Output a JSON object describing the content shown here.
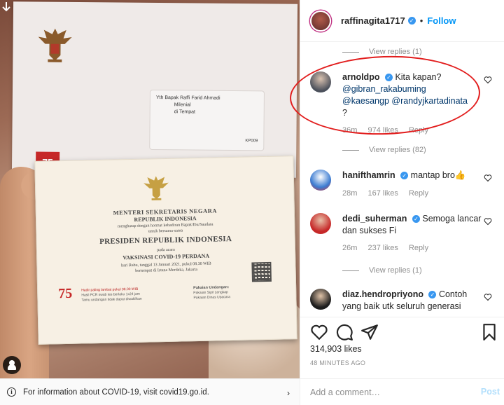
{
  "photo": {
    "envelope": {
      "recipient_line1": "Yth Bapak Raffi Farid Ahmadi",
      "recipient_line2": "Milenial",
      "recipient_line3": "di Tempat",
      "code": "KP009",
      "emblem_text": "75"
    },
    "invitation": {
      "title1": "MENTERI SEKRETARIS NEGARA",
      "title2": "REPUBLIK INDONESIA",
      "small1": "mengharap dengan hormat kehadiran Bapak/Ibu/Saudara",
      "small2": "untuk bersama-sama",
      "head": "PRESIDEN REPUBLIK INDONESIA",
      "small3": "pada acara",
      "event": "VAKSINASI COVID-19 PERDANA",
      "small4": "hari Rabu, tanggal 13 Januari 2021, pukul 08.30 WIB",
      "small5": "bertempat di Istana Merdeka, Jakarta",
      "emblem_text": "75",
      "notes_line1": "Hadir paling lambat pukul 08.00 WIB",
      "notes_line2": "Hasil PCR swab tes berlaku 1x24 jam",
      "notes_line3": "Tamu undangan tidak dapat diwakilkan",
      "dress_title": "Pakaian Undangan:",
      "dress_line1": "Pakaian Sipil Lengkap",
      "dress_line2": "Pakaian Dinas Upacara"
    }
  },
  "covid_bar": {
    "text": "For information about COVID-19, visit covid19.go.id."
  },
  "header": {
    "username": "raffinagita1717",
    "follow_label": "Follow",
    "dot": "•"
  },
  "comments": {
    "view_replies_top": "View replies (1)",
    "view_replies_82": "View replies (82)",
    "view_replies_bottom": "View replies (1)",
    "items": [
      {
        "username": "arnoldpo",
        "text": "Kita kapan?",
        "mention1": "@gibran_rakabuming",
        "mention2": "@kaesangp",
        "mention3": "@randyjkartadinata",
        "trailing": "?",
        "time": "36m",
        "likes": "974 likes",
        "reply": "Reply"
      },
      {
        "username": "hanifthamrin",
        "text": "mantap bro👍",
        "time": "28m",
        "likes": "167 likes",
        "reply": "Reply"
      },
      {
        "username": "dedi_suherman",
        "text": "Semoga lancar dan sukses Fi",
        "time": "26m",
        "likes": "237 likes",
        "reply": "Reply"
      },
      {
        "username": "diaz.hendropriyono",
        "text": "Contoh yang baik utk seluruh generasi"
      }
    ]
  },
  "actions": {
    "likes": "314,903 likes",
    "time_ago": "48 MINUTES AGO"
  },
  "add_comment": {
    "placeholder": "Add a comment…",
    "post_label": "Post"
  },
  "colors": {
    "accent": "#0095f6",
    "verified": "#3897f0",
    "annotation": "#e21d1d"
  }
}
